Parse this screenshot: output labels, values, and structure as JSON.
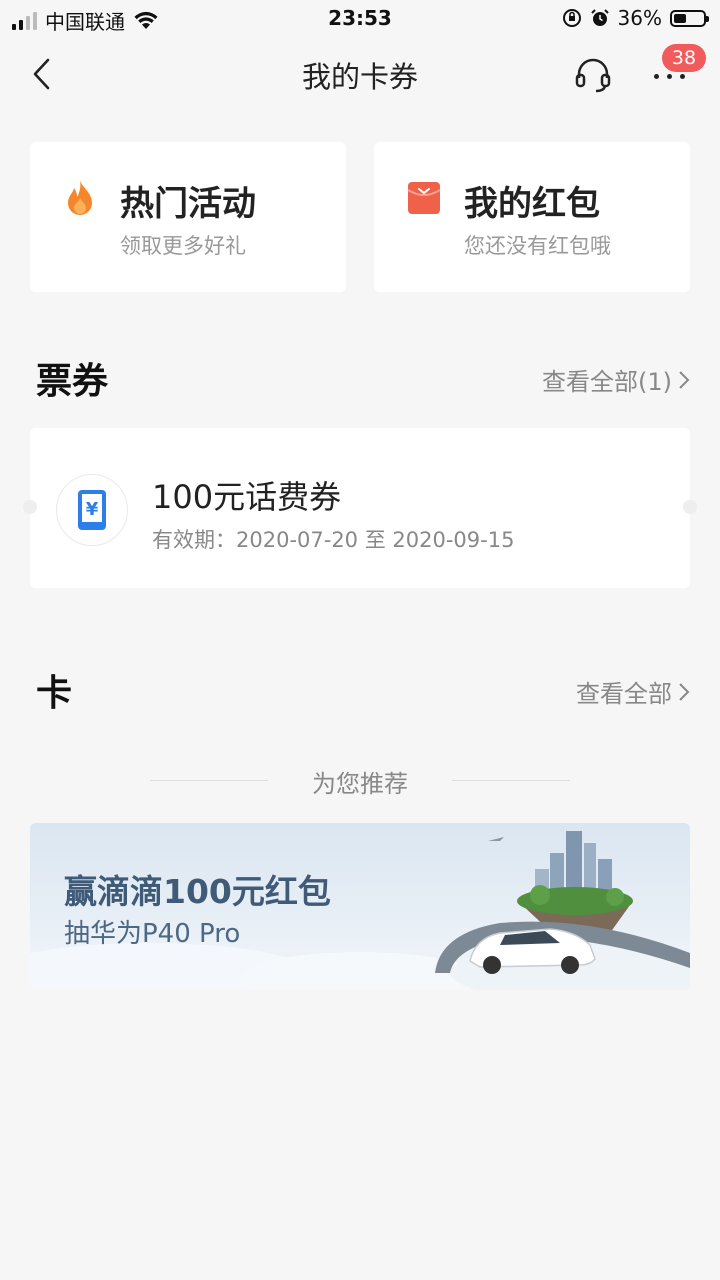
{
  "status_bar": {
    "carrier": "中国联通",
    "time": "23:53",
    "battery": "36%"
  },
  "header": {
    "title": "我的卡券",
    "badge_count": "38"
  },
  "quick_cards": [
    {
      "title": "热门活动",
      "subtitle": "领取更多好礼",
      "icon": "fire-icon"
    },
    {
      "title": "我的红包",
      "subtitle": "您还没有红包哦",
      "icon": "red-envelope-icon"
    }
  ],
  "tickets": {
    "title": "票券",
    "view_all": "查看全部(1)",
    "items": [
      {
        "title": "100元话费券",
        "validity": "有效期：2020-07-20 至 2020-09-15",
        "icon": "phone-yuan-icon"
      }
    ]
  },
  "cards": {
    "title": "卡",
    "view_all": "查看全部"
  },
  "recommend": {
    "label": "为您推荐",
    "banner_title": "赢滴滴100元红包",
    "banner_subtitle": "抽华为P40 Pro"
  },
  "colors": {
    "accent_orange": "#f5862b",
    "red_envelope": "#f0614a",
    "badge_red": "#f25b5b",
    "ticket_blue": "#2c7ee8"
  }
}
